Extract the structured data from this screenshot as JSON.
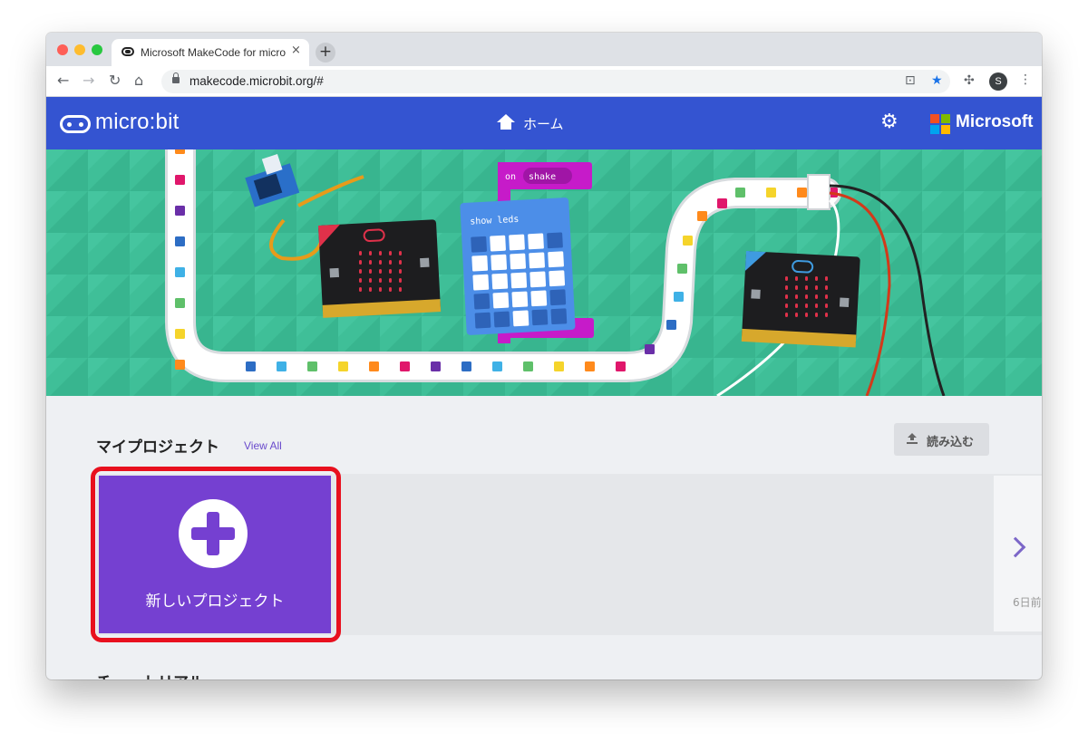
{
  "browser": {
    "tab_title": "Microsoft MakeCode for micro:bit",
    "tab_close": "×",
    "new_tab": "+",
    "url": "makecode.microbit.org/#",
    "profile_initial": "S"
  },
  "header": {
    "brand": "micro:bit",
    "home_label": "ホーム",
    "microsoft": "Microsoft",
    "ms_colors": [
      "#f25022",
      "#7fba00",
      "#00a4ef",
      "#ffb900"
    ]
  },
  "hero": {
    "block_event": "on",
    "block_event_arg": "shake",
    "block_action": "show leds"
  },
  "projects": {
    "title": "マイプロジェクト",
    "view_all": "View All",
    "import_label": "読み込む",
    "new_project_label": "新しいプロジェクト",
    "recent_time": "6日前"
  },
  "tutorials": {
    "title": "チュートリアル"
  },
  "colors": {
    "header_blue": "#3454d1",
    "hero_green": "#3fbf98",
    "new_project_purple": "#7540d1",
    "highlight_red": "#e8101e"
  }
}
